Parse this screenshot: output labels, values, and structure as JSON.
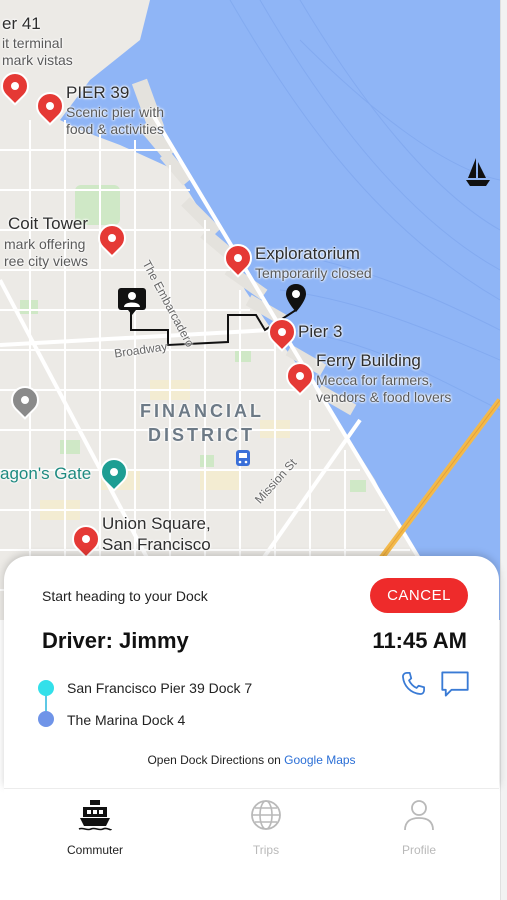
{
  "map": {
    "labels": {
      "pier41": "er 41",
      "pier41_sub1": "it terminal",
      "pier41_sub2": "mark vistas",
      "pier39": "PIER 39",
      "pier39_sub1": "Scenic pier with",
      "pier39_sub2": "food & activities",
      "coit": "Coit Tower",
      "coit_sub1": "mark offering",
      "coit_sub2": "ree city views",
      "exploratorium": "Exploratorium",
      "exploratorium_sub": "Temporarily closed",
      "pier3": "Pier 3",
      "ferry": "Ferry Building",
      "ferry_sub1": "Mecca for farmers,",
      "ferry_sub2": "vendors & food lovers",
      "financial1": "FINANCIAL",
      "financial2": "DISTRICT",
      "dragons_gate": "agon's Gate",
      "union1": "Union Square,",
      "union2": "San Francisco",
      "embarcadero": "The Embarcadero",
      "broadway": "Broadway",
      "mission": "Mission St"
    },
    "colors": {
      "water": "#8fb5f6",
      "land": "#eceae6",
      "park": "#cfe8c6",
      "route": "#111111",
      "poi_red": "#e53935",
      "poi_teal": "#1e9e93",
      "bridge": "#f3b94a"
    }
  },
  "sheet": {
    "status": "Start heading to your Dock",
    "cancel_label": "CANCEL",
    "driver": "Driver: Jimmy",
    "eta": "11:45 AM",
    "stop_start": "San Francisco Pier 39 Dock 7",
    "stop_end": "The Marina Dock 4",
    "open_prefix": "Open Dock Directions on ",
    "open_link": "Google Maps",
    "icons": {
      "call": "phone-icon",
      "message": "message-icon"
    },
    "colors": {
      "cancel": "#ee2b2b",
      "start_dot": "#33e0ea",
      "end_dot": "#6f94e8",
      "action_icons": "#3a7bd5"
    }
  },
  "nav": {
    "items": [
      {
        "label": "Commuter",
        "icon": "ferry-icon",
        "active": true
      },
      {
        "label": "Trips",
        "icon": "globe-icon",
        "active": false
      },
      {
        "label": "Profile",
        "icon": "person-icon",
        "active": false
      }
    ]
  }
}
